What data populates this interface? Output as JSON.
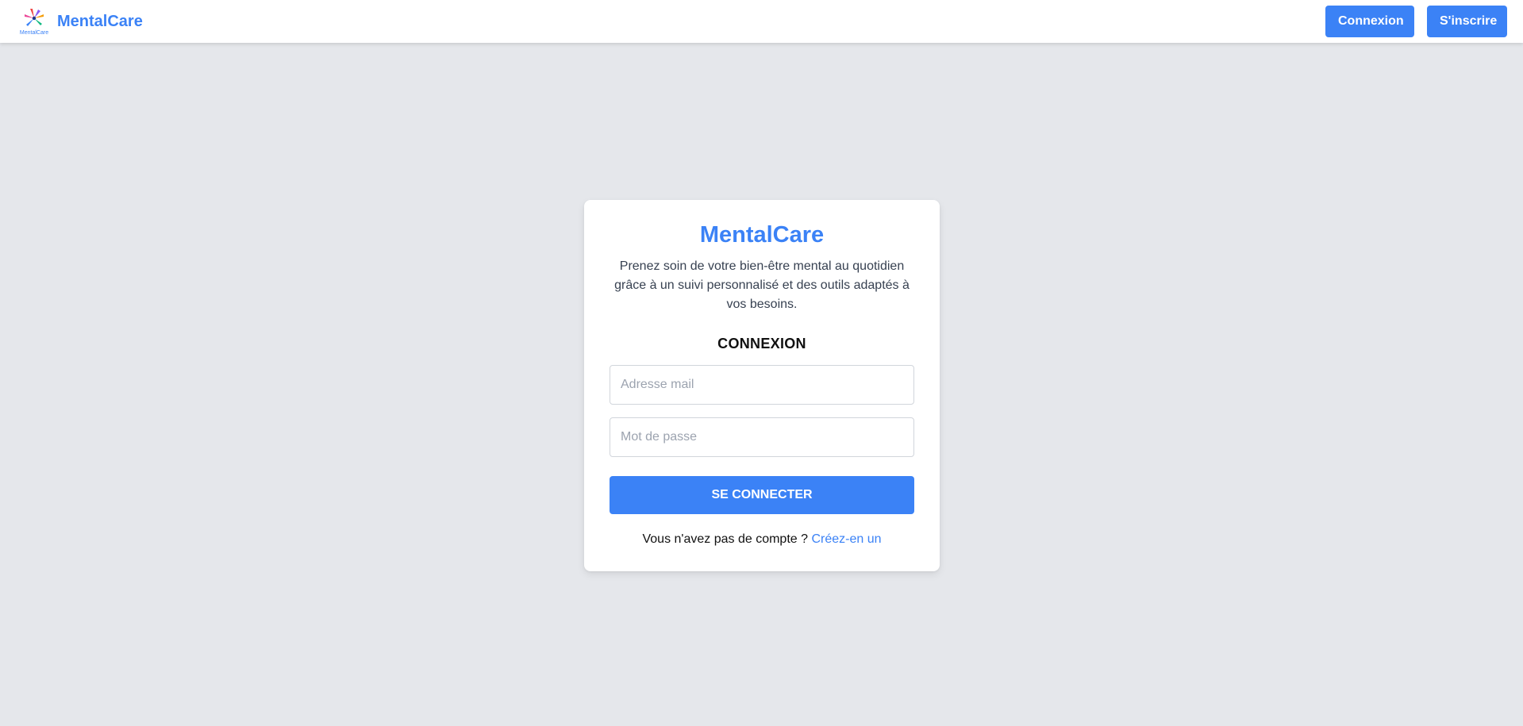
{
  "navbar": {
    "brand_name": "MentalCare",
    "logo_text": "MentalCare",
    "login_label": "Connexion",
    "signup_label": "S'inscrire"
  },
  "card": {
    "title": "MentalCare",
    "description": "Prenez soin de votre bien-être mental au quotidien grâce à un suivi personnalisé et des outils adaptés à vos besoins.",
    "form_heading": "CONNEXION",
    "email_placeholder": "Adresse mail",
    "email_value": "",
    "password_placeholder": "Mot de passe",
    "password_value": "",
    "submit_label": "SE CONNECTER",
    "no_account_text": "Vous n'avez pas de compte ?",
    "create_link": "Créez-en un"
  },
  "colors": {
    "accent": "#3b82f6",
    "background": "#e5e7eb",
    "card": "#ffffff"
  },
  "icons": {
    "logo": "mentalcare-logo-icon"
  }
}
